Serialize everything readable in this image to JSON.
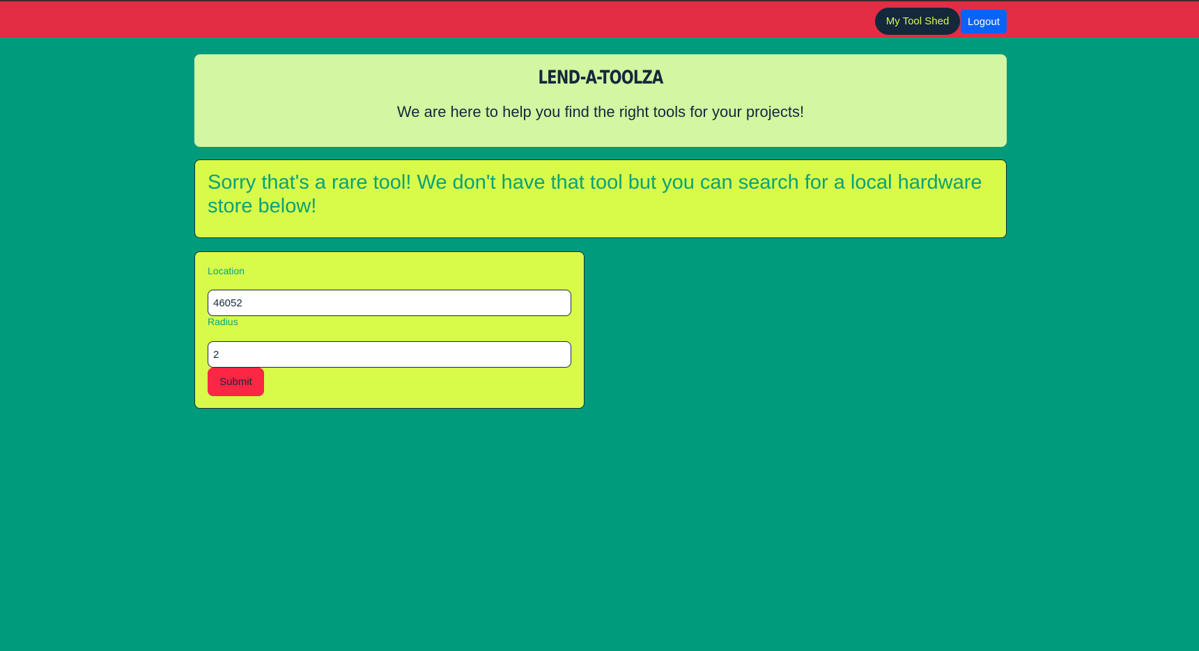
{
  "nav": {
    "tool_shed_label": "My Tool Shed",
    "logout_label": "Logout"
  },
  "hero": {
    "title": "LEND-A-TOOLZA",
    "subtitle": "We are here to help you find the right tools for your projects!"
  },
  "alert": {
    "message": "Sorry that's a rare tool! We don't have that tool but you can search for a local hardware store below!"
  },
  "form": {
    "location_label": "Location",
    "location_value": "46052",
    "radius_label": "Radius",
    "radius_value": "2",
    "submit_label": "Submit"
  },
  "colors": {
    "page_bg": "#009b7d",
    "topbar": "#e22d44",
    "hero_bg": "#d2f6a2",
    "card_bg": "#d8fb4a",
    "accent_text": "#08a17b",
    "dark": "#14283c",
    "logout_blue": "#0a63f8",
    "submit_red": "#fc2645"
  }
}
